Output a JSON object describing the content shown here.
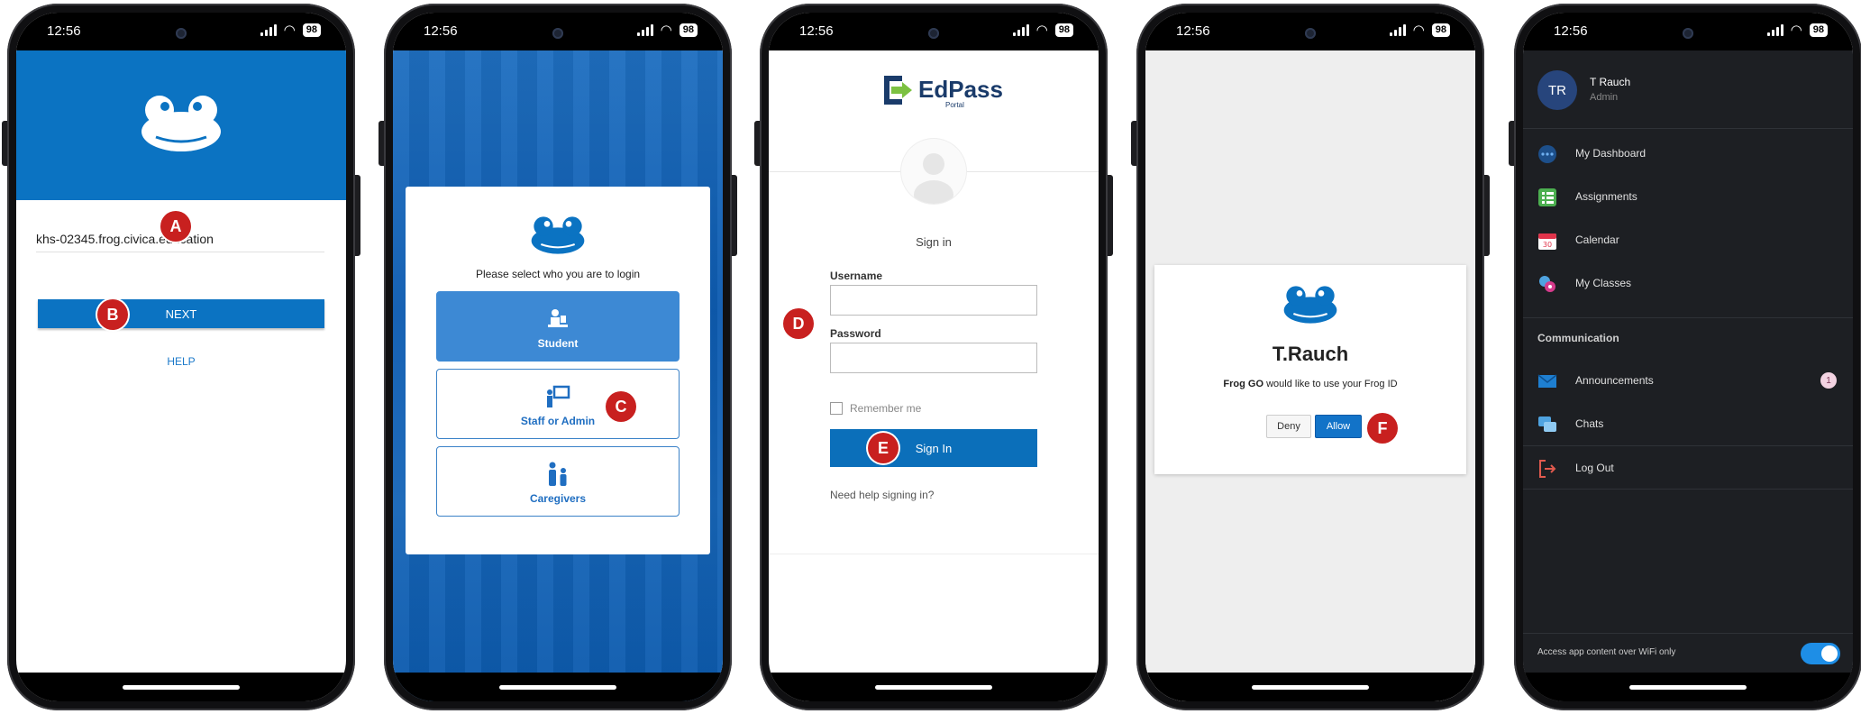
{
  "status": {
    "time": "12:56",
    "battery": "98"
  },
  "markers": [
    "A",
    "B",
    "C",
    "D",
    "E",
    "F"
  ],
  "screen1": {
    "domain": "khs-02345.frog.civica.education",
    "next_label": "NEXT",
    "help_label": "HELP"
  },
  "screen2": {
    "prompt": "Please select who you are to login",
    "roles": [
      "Student",
      "Staff or Admin",
      "Caregivers"
    ]
  },
  "screen3": {
    "logo_text": "EdPass",
    "logo_sub": "Portal",
    "title": "Sign in",
    "username_label": "Username",
    "password_label": "Password",
    "remember_label": "Remember me",
    "signin_label": "Sign In",
    "help_label": "Need help signing in?"
  },
  "screen4": {
    "name": "T.Rauch",
    "msg_bold": "Frog GO",
    "msg_rest": " would like to use your Frog ID",
    "deny_label": "Deny",
    "allow_label": "Allow"
  },
  "screen5": {
    "initials": "TR",
    "user_name": "T Rauch",
    "user_role": "Admin",
    "menu": [
      "My Dashboard",
      "Assignments",
      "Calendar",
      "My Classes"
    ],
    "section": "Communication",
    "comm": [
      "Announcements",
      "Chats"
    ],
    "announcements_badge": "1",
    "logout": "Log Out",
    "footer_text": "Access app content over WiFi only",
    "calendar_day": "30"
  },
  "colors": {
    "frog_blue": "#0b73c2",
    "marker_red": "#c8201f",
    "dark_bg": "#1d1f23",
    "toggle_on": "#1e8ee6"
  }
}
